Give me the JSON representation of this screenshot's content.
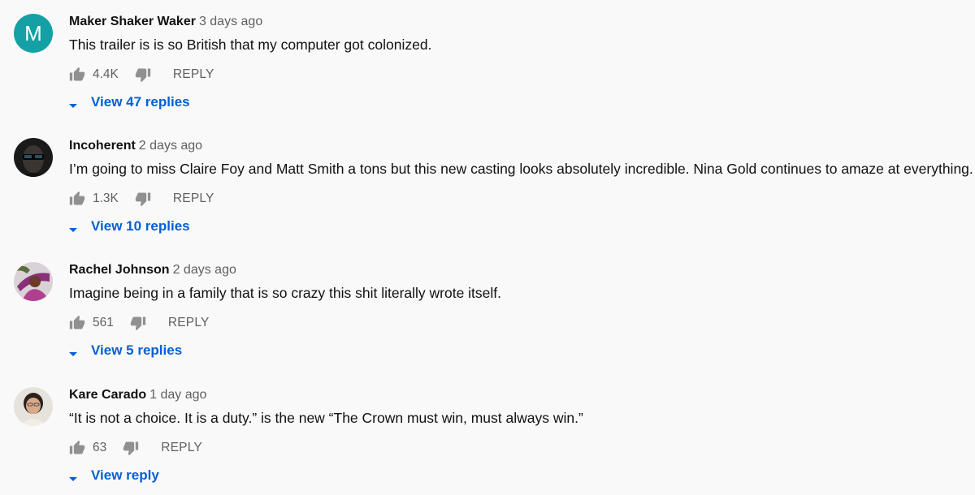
{
  "colors": {
    "background": "#f9f9f9",
    "link_blue": "#065fd4",
    "meta_gray": "#606060",
    "avatar_teal": "#14a0a4"
  },
  "comments": [
    {
      "avatar_letter": "M",
      "avatar_type": "letter",
      "author": "Maker Shaker Waker",
      "time": "3 days ago",
      "text": "This trailer is is so British that my computer got colonized.",
      "likes": "4.4K",
      "reply_label": "REPLY",
      "view_replies": "View 47 replies",
      "icons": [
        "thumbs-up-icon",
        "thumbs-down-icon",
        "caret-down-icon"
      ]
    },
    {
      "avatar_type": "photo",
      "author": "Incoherent",
      "time": "2 days ago",
      "text": "I’m going to miss Claire Foy and Matt Smith a tons but this new casting looks absolutely incredible. Nina Gold continues to amaze at everything.",
      "likes": "1.3K",
      "reply_label": "REPLY",
      "view_replies": "View 10 replies",
      "icons": [
        "thumbs-up-icon",
        "thumbs-down-icon",
        "caret-down-icon"
      ]
    },
    {
      "avatar_type": "photo",
      "author": "Rachel Johnson",
      "time": "2 days ago",
      "text": "Imagine being in a family that is so crazy this shit literally wrote itself.",
      "likes": "561",
      "reply_label": "REPLY",
      "view_replies": "View 5 replies",
      "icons": [
        "thumbs-up-icon",
        "thumbs-down-icon",
        "caret-down-icon"
      ]
    },
    {
      "avatar_type": "photo",
      "author": "Kare Carado",
      "time": "1 day ago",
      "text": "“It is not a choice. It is a duty.” is the new “The Crown must win, must always win.”",
      "likes": "63",
      "reply_label": "REPLY",
      "view_replies": "View reply",
      "icons": [
        "thumbs-up-icon",
        "thumbs-down-icon",
        "caret-down-icon"
      ]
    }
  ]
}
